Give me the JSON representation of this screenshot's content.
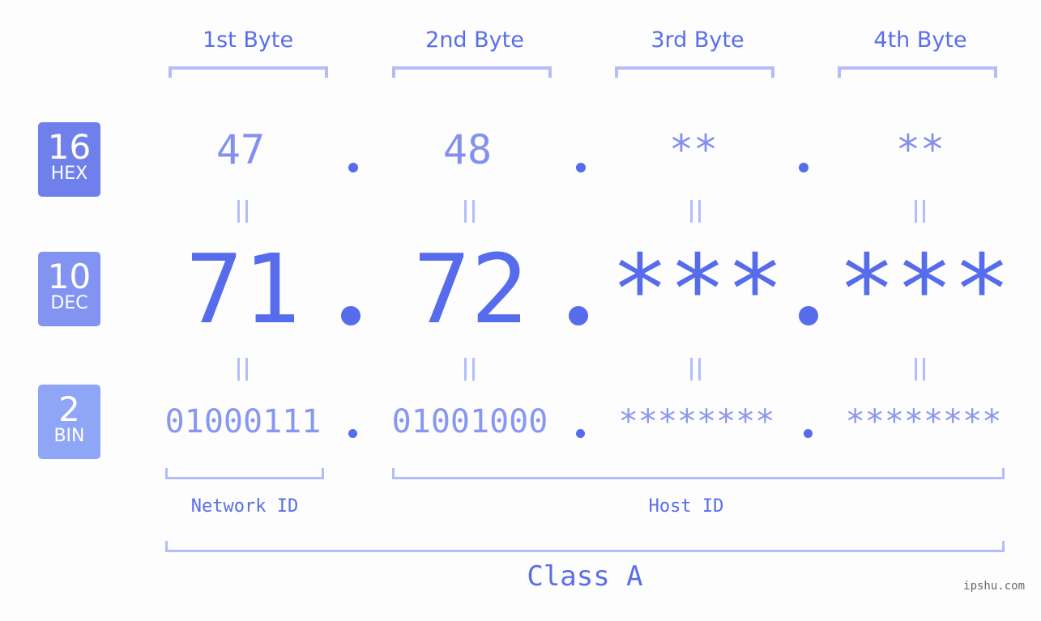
{
  "byte_headers": [
    "1st Byte",
    "2nd Byte",
    "3rd Byte",
    "4th Byte"
  ],
  "badges": [
    {
      "base": "16",
      "label": "HEX",
      "color": "#6f80ea"
    },
    {
      "base": "10",
      "label": "DEC",
      "color": "#8393f2"
    },
    {
      "base": "2",
      "label": "BIN",
      "color": "#8fa6f6"
    }
  ],
  "hex": [
    "47",
    "48",
    "**",
    "**"
  ],
  "dec": [
    "71",
    "72",
    "***",
    "***"
  ],
  "bin": [
    "01000111",
    "01001000",
    "********",
    "********"
  ],
  "separator": ".",
  "network_label": "Network ID",
  "host_label": "Host ID",
  "class_label": "Class A",
  "watermark": "ipshu.com",
  "colors": {
    "accent": "#566cec",
    "bracket": "#b3bdfa"
  }
}
